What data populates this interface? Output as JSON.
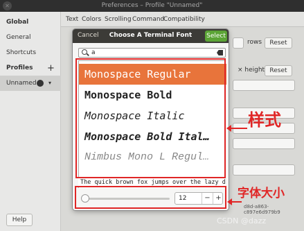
{
  "window": {
    "title": "Preferences – Profile \"Unnamed\""
  },
  "sidebar": {
    "items": [
      {
        "label": "Global"
      },
      {
        "label": "General"
      },
      {
        "label": "Shortcuts"
      },
      {
        "label": "Profiles"
      },
      {
        "label": "Unnamed"
      }
    ],
    "help_label": "Help"
  },
  "tabs": [
    "Text",
    "Colors",
    "Scrolling",
    "Command",
    "Compatibility"
  ],
  "right_panel": {
    "rows_label": "rows",
    "height_label": "× height",
    "reset_label": "Reset",
    "hash_text": "d8d-a863-c897e6d979b9"
  },
  "dialog": {
    "title": "Choose A Terminal Font",
    "cancel_label": "Cancel",
    "select_label": "Select",
    "search_value": "a",
    "fonts": [
      "Monospace Regular",
      "Monospace Bold",
      "Monospace Italic",
      "Monospace Bold Ital…",
      "Nimbus Mono L Regul…"
    ],
    "preview_text": "The quick brown fox jumps over the lazy dog",
    "size_value": "12",
    "minus_label": "−",
    "plus_label": "+"
  },
  "annotations": {
    "style_label": "样式",
    "size_label": "字体大小",
    "color": "#e02626"
  },
  "watermark": "CSDN @dazz"
}
